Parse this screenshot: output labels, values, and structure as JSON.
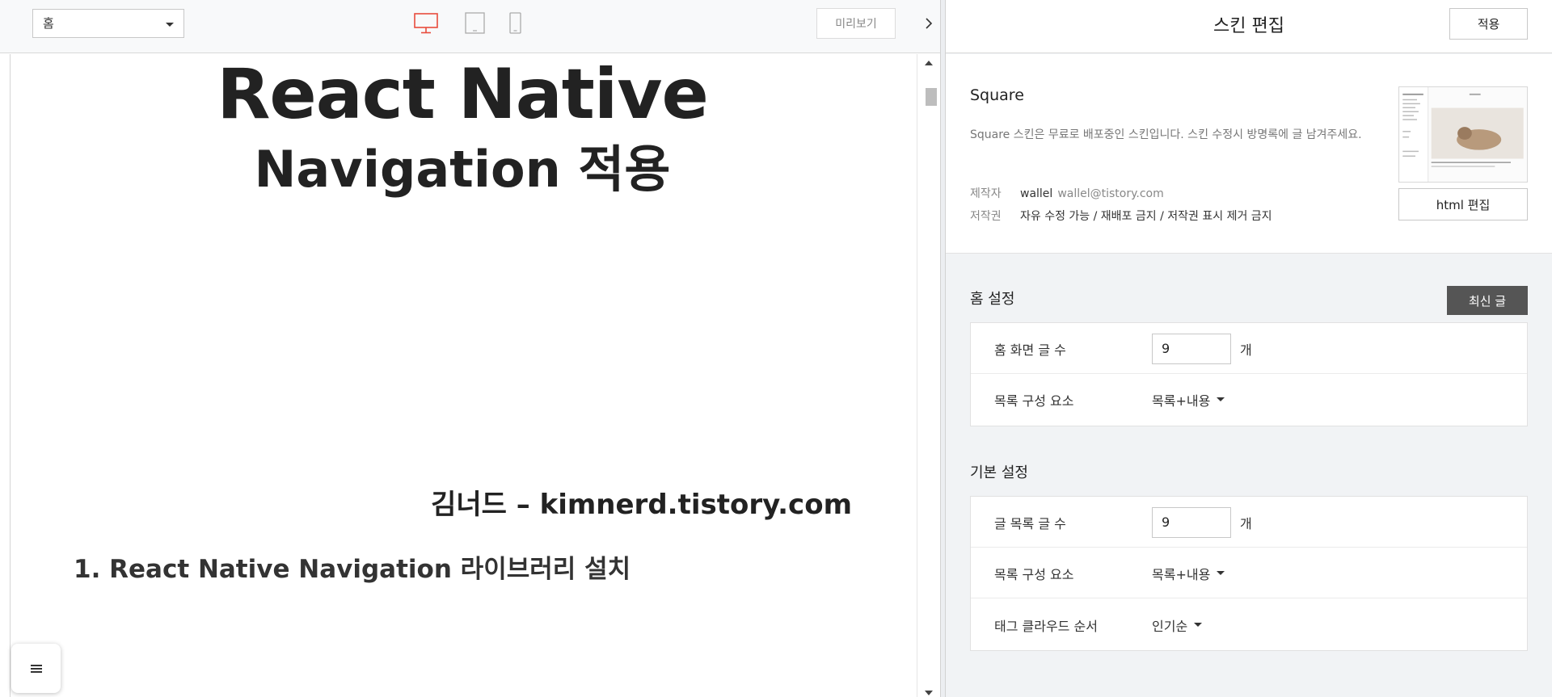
{
  "toolbar": {
    "page_select": "홈",
    "preview_label": "미리보기",
    "devices": {
      "desktop": "desktop-icon",
      "tablet": "tablet-icon",
      "mobile": "mobile-icon"
    },
    "active_color": "#e84c3d"
  },
  "post": {
    "title_line1": "React Native",
    "title_line2": "Navigation 적용",
    "credit": "김너드 – kimnerd.tistory.com",
    "heading": "1. React Native Navigation 라이브러리 설치"
  },
  "panel": {
    "title": "스킨 편집",
    "apply_label": "적용",
    "skin": {
      "name": "Square",
      "description": "Square 스킨은 무료로 배포중인 스킨입니다. 스킨 수정시 방명록에 글 남겨주세요.",
      "maker_key": "제작자",
      "maker_name": "wallel",
      "maker_email": "wallel@tistory.com",
      "copyright_key": "저작권",
      "copyright_value": "자유 수정 가능 / 재배포 금지 / 저작권 표시 제거 금지",
      "html_edit_label": "html 편집"
    },
    "home_settings": {
      "title": "홈 설정",
      "latest_label": "최신 글",
      "post_count_label": "홈 화면 글 수",
      "post_count_value": "9",
      "unit": "개",
      "list_element_label": "목록 구성 요소",
      "list_element_value": "목록+내용"
    },
    "basic_settings": {
      "title": "기본 설정",
      "list_count_label": "글 목록 글 수",
      "list_count_value": "9",
      "unit": "개",
      "list_element_label": "목록 구성 요소",
      "list_element_value": "목록+내용",
      "tag_order_label": "태그 클라우드 순서",
      "tag_order_value": "인기순"
    }
  }
}
